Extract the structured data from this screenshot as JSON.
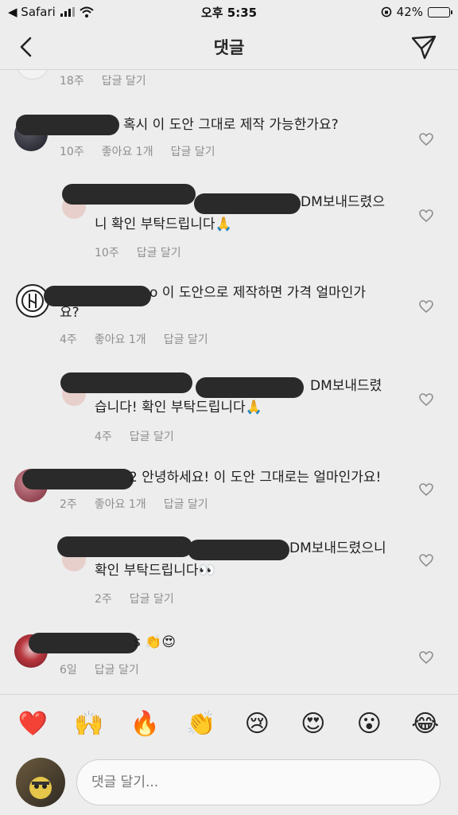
{
  "status_bar": {
    "back_app": "◀ Safari",
    "time": "오후 5:35",
    "battery_percent": "42%",
    "battery_level": 0.42
  },
  "header": {
    "title": "댓글"
  },
  "comments": [
    {
      "id": "c0",
      "time": "18주",
      "likes": "",
      "reply": "답글 달기"
    },
    {
      "id": "c1",
      "text": "혹시 이 도안 그대로 제작 가능한가요?",
      "time": "10주",
      "likes": "좋아요 1개",
      "reply": "답글 달기"
    },
    {
      "id": "c2",
      "text_line1": "DM보내드렸으",
      "text_line2": "니 확인 부탁드립니다🙏",
      "time": "10주",
      "reply": "답글 달기"
    },
    {
      "id": "c3",
      "text_line1": "o 이 도안으로 제작하면 가격 얼마인가",
      "text_line2": "요?",
      "time": "4주",
      "likes": "좋아요 1개",
      "reply": "답글 달기"
    },
    {
      "id": "c4",
      "text_line1": "DM보내드렸",
      "text_line2": "습니다! 확인 부탁드립니다🙏",
      "time": "4주",
      "reply": "답글 달기"
    },
    {
      "id": "c5",
      "text": "2 안녕하세요! 이 도안 그대로는 얼마인가요!",
      "time": "2주",
      "likes": "좋아요 1개",
      "reply": "답글 달기"
    },
    {
      "id": "c6",
      "text_line1": "DM보내드렸으니",
      "text_line2": "확인 부탁드립니다👀",
      "time": "2주",
      "reply": "답글 달기"
    },
    {
      "id": "c7",
      "text": "s 👏😍",
      "time": "6일",
      "reply": "답글 달기"
    }
  ],
  "emoji_bar": [
    "❤️",
    "🙌",
    "🔥",
    "👏",
    "😢",
    "😍",
    "😮",
    "😂"
  ],
  "composer": {
    "placeholder": "댓글 달기..."
  }
}
